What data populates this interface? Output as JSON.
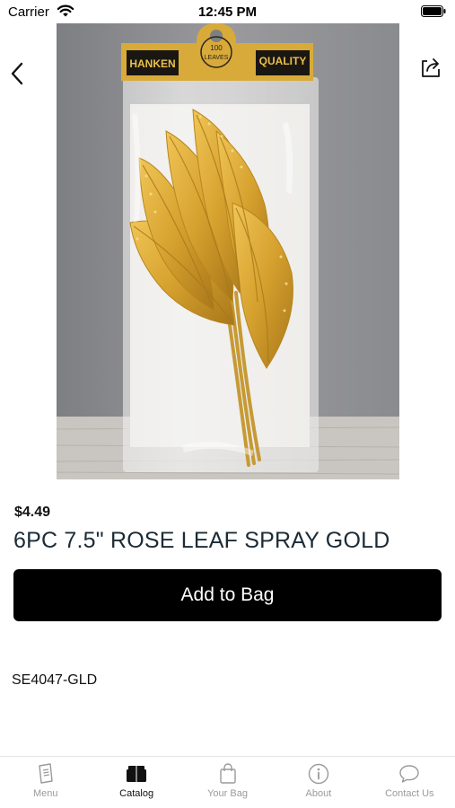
{
  "status_bar": {
    "carrier": "Carrier",
    "time": "12:45 PM"
  },
  "product": {
    "image_text": {
      "header_left": "HANKEN",
      "header_right": "QUALITY",
      "tag_top": "100",
      "tag_bottom": "LEAVES"
    },
    "price": "$4.49",
    "title": "6PC 7.5\" ROSE LEAF SPRAY GOLD",
    "add_to_bag_label": "Add to Bag",
    "sku": "SE4047-GLD"
  },
  "tab_bar": {
    "active_tab": "Catalog",
    "tabs": [
      {
        "label": "Menu",
        "icon": "menu-book-icon"
      },
      {
        "label": "Catalog",
        "icon": "catalog-box-icon"
      },
      {
        "label": "Your Bag",
        "icon": "shopping-bag-icon"
      },
      {
        "label": "About",
        "icon": "info-icon"
      },
      {
        "label": "Contact Us",
        "icon": "chat-bubble-icon"
      }
    ]
  },
  "colors": {
    "button_background": "#000000",
    "active_tab_text": "#111111",
    "inactive_tab_text": "#9a9a9a",
    "leaf_gold": "#d9a531"
  }
}
